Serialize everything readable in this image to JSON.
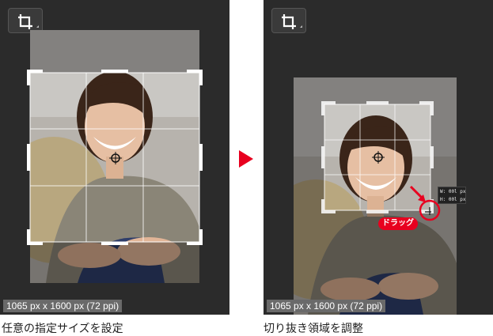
{
  "left_panel": {
    "tool_icon": "crop-icon",
    "image_size_label": "1065 px x 1600 px (72 ppi)",
    "caption": "任意の指定サイズを設定"
  },
  "right_panel": {
    "tool_icon": "crop-icon",
    "image_size_label": "1065 px x 1600 px (72 ppi)",
    "caption": "切り抜き領域を調整",
    "drag_label": "ドラッグ",
    "readout_w": "W: 00l px",
    "readout_h": "H: 00l px"
  },
  "arrow_icon": "right-triangle-arrow-icon",
  "colors": {
    "panel_bg": "#2b2b2b",
    "accent_red": "#e8001f",
    "label_bg": "#6a6a6a"
  }
}
